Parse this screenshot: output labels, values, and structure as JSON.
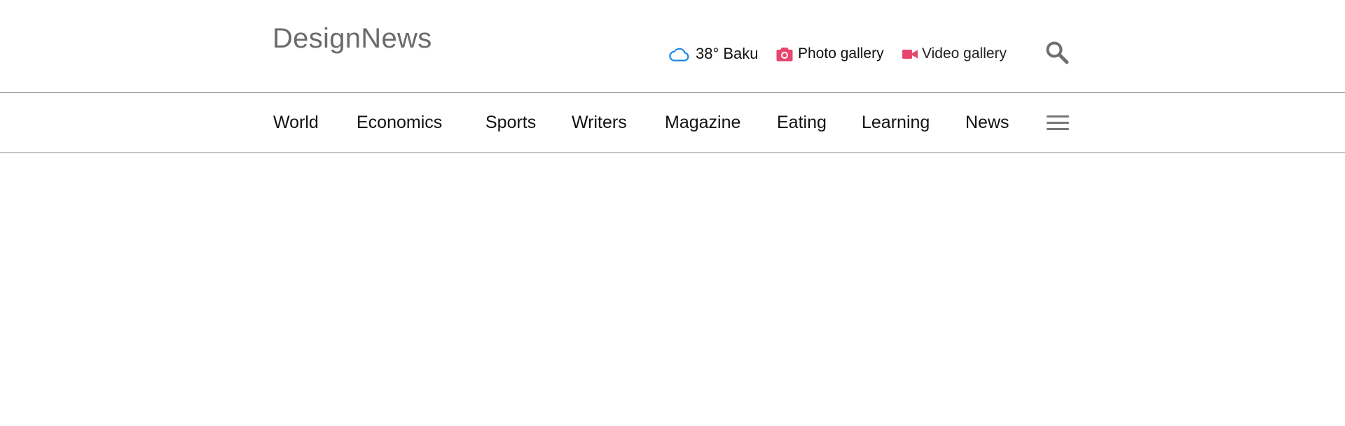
{
  "header": {
    "logo_text": "DesignNews",
    "weather": {
      "icon": "cloud-icon",
      "text": "38° Baku",
      "icon_color": "#1e88e5"
    },
    "photo_gallery": {
      "icon": "camera-icon",
      "label": "Photo gallery",
      "icon_color": "#e8456e"
    },
    "video_gallery": {
      "icon": "video-camera-icon",
      "label": "Video gallery",
      "icon_color": "#e8456e"
    },
    "search": {
      "icon": "search-icon",
      "icon_color": "#6f6f6f"
    }
  },
  "nav": {
    "items": [
      {
        "label": "World"
      },
      {
        "label": "Economics"
      },
      {
        "label": "Sports"
      },
      {
        "label": "Writers"
      },
      {
        "label": "Magazine"
      },
      {
        "label": "Eating"
      },
      {
        "label": "Learning"
      },
      {
        "label": "News"
      }
    ],
    "menu_icon": "hamburger-menu-icon"
  },
  "colors": {
    "divider": "#8f8f8f",
    "text": "#111111",
    "logo": "#6b6b6b"
  }
}
